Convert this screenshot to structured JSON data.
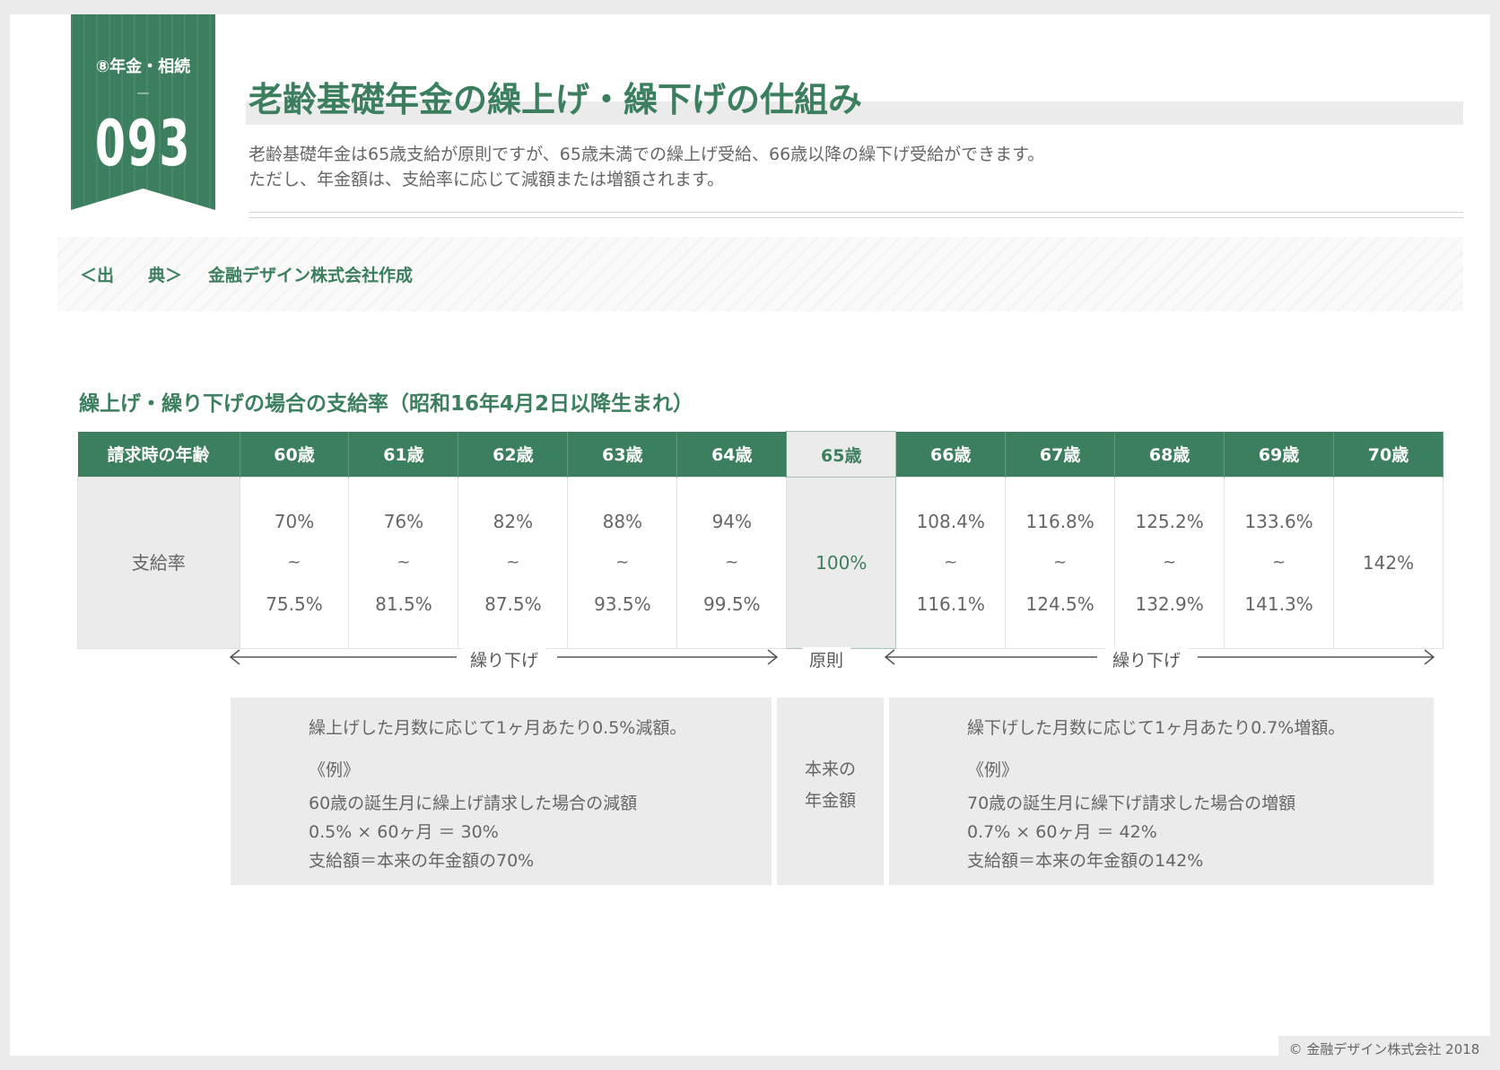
{
  "badge": {
    "category": "⑧年金・相続",
    "dash": "—",
    "number": "093"
  },
  "title": "老齢基礎年金の繰上げ・繰下げの仕組み",
  "lead": [
    "老齢基礎年金は65歳支給が原則ですが、65歳未満での繰上げ受給、66歳以降の繰下げ受給ができます。",
    "ただし、年金額は、支給率に応じて減額または増額されます。"
  ],
  "source": {
    "label": "＜出　　典＞",
    "value": "金融デザイン株式会社作成"
  },
  "section_title": "繰上げ・繰り下げの場合の支給率（昭和16年4月2日以降生まれ）",
  "table": {
    "row_header_top": "請求時の年齢",
    "row_header_bottom": "支給率",
    "columns": [
      {
        "age": "60歳",
        "low": "70%",
        "tilde": "~",
        "high": "75.5%"
      },
      {
        "age": "61歳",
        "low": "76%",
        "tilde": "~",
        "high": "81.5%"
      },
      {
        "age": "62歳",
        "low": "82%",
        "tilde": "~",
        "high": "87.5%"
      },
      {
        "age": "63歳",
        "low": "88%",
        "tilde": "~",
        "high": "93.5%"
      },
      {
        "age": "64歳",
        "low": "94%",
        "tilde": "~",
        "high": "99.5%"
      },
      {
        "age": "65歳",
        "single": "100%"
      },
      {
        "age": "66歳",
        "low": "108.4%",
        "tilde": "~",
        "high": "116.1%"
      },
      {
        "age": "67歳",
        "low": "116.8%",
        "tilde": "~",
        "high": "124.5%"
      },
      {
        "age": "68歳",
        "low": "125.2%",
        "tilde": "~",
        "high": "132.9%"
      },
      {
        "age": "69歳",
        "low": "133.6%",
        "tilde": "~",
        "high": "141.3%"
      },
      {
        "age": "70歳",
        "single": "142%"
      }
    ]
  },
  "arrows": {
    "left_label": "繰り下げ",
    "center_label": "原則",
    "right_label": "繰り下げ"
  },
  "left_box": {
    "line1": "繰上げした月数に応じて1ヶ月あたり0.5%減額。",
    "example": "《例》",
    "line2": "60歳の誕生月に繰上げ請求した場合の減額",
    "line3": "0.5% × 60ヶ月 ＝ 30%",
    "line4": "支給額＝本来の年金額の70%"
  },
  "mid_box": {
    "line1": "本来の",
    "line2": "年金額"
  },
  "right_box": {
    "line1": "繰下げした月数に応じて1ヶ月あたり0.7%増額。",
    "example": "《例》",
    "line2": "70歳の誕生月に繰下げ請求した場合の増額",
    "line3": "0.7% × 60ヶ月 ＝ 42%",
    "line4": "支給額＝本来の年金額の142%"
  },
  "copyright": "© 金融デザイン株式会社 2018",
  "colors": {
    "accent": "#3c7f5e",
    "panel": "#ebebeb"
  }
}
